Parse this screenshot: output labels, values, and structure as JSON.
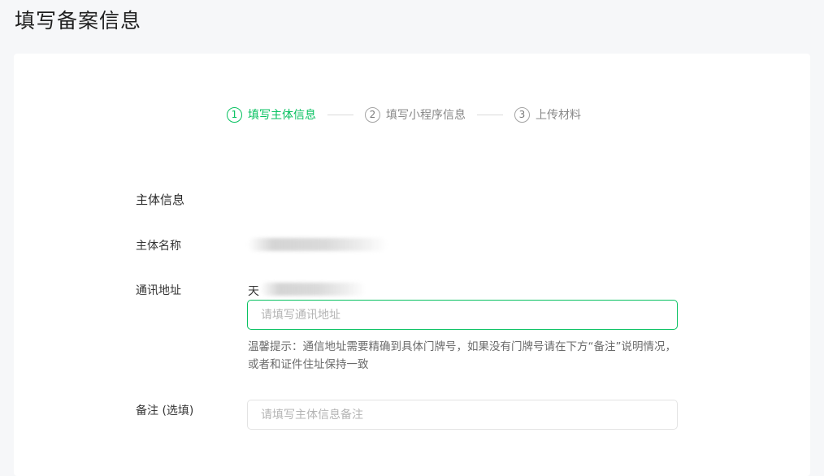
{
  "page": {
    "title": "填写备案信息"
  },
  "steps": [
    {
      "num": "1",
      "label": "填写主体信息",
      "active": true
    },
    {
      "num": "2",
      "label": "填写小程序信息",
      "active": false
    },
    {
      "num": "3",
      "label": "上传材料",
      "active": false
    }
  ],
  "form": {
    "section_title": "主体信息",
    "subject_name_label": "主体名称",
    "address_label": "通讯地址",
    "address_prefix": "天",
    "address_placeholder": "请填写通讯地址",
    "address_hint": "温馨提示：通信地址需要精确到具体门牌号，如果没有门牌号请在下方“备注”说明情况，或者和证件住址保持一致",
    "remark_label": "备注 (选填)",
    "remark_placeholder": "请填写主体信息备注"
  },
  "colors": {
    "accent": "#07c160",
    "muted": "#888888",
    "background": "#f6f7f9"
  }
}
